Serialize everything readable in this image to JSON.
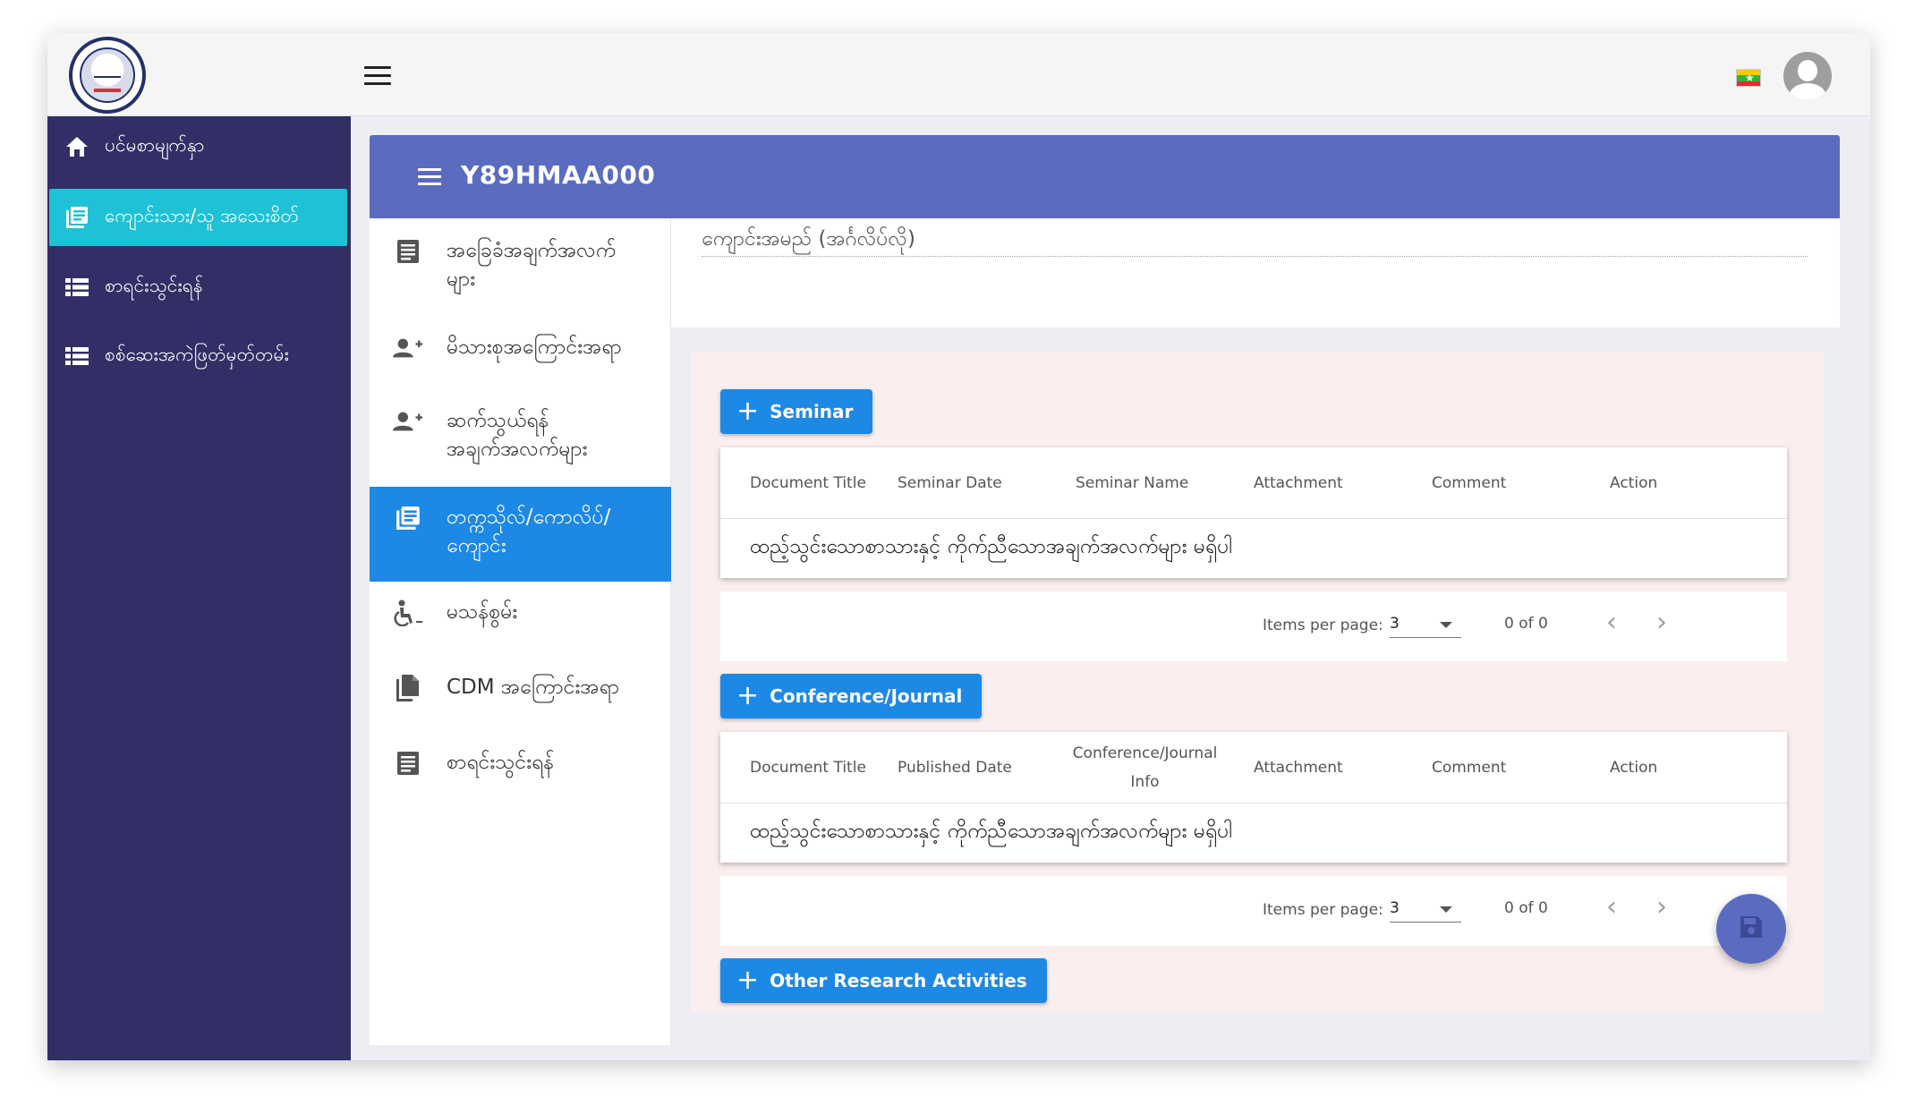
{
  "header": {
    "language_flag": "myanmar-flag"
  },
  "sidebar": {
    "items": [
      {
        "label": "ပင်မစာမျက်နှာ",
        "icon": "home-icon"
      },
      {
        "label": "ကျောင်းသား/သူ အသေးစိတ်",
        "icon": "document-list-icon"
      },
      {
        "label": "စာရင်းသွင်းရန်",
        "icon": "list-icon"
      },
      {
        "label": "စစ်ဆေးအကဲဖြတ်မှတ်တမ်း",
        "icon": "list-icon"
      }
    ]
  },
  "card": {
    "title": "Y89HMAA000"
  },
  "tabs": [
    {
      "label": "အခြေခံအချက်အလက်များ",
      "line1": "အခြေခံအချက်အလက်",
      "line2": "များ",
      "icon": "details-icon"
    },
    {
      "label": "မိသားစုအကြောင်းအရာ",
      "icon": "person-add-icon"
    },
    {
      "label": "ဆက်သွယ်ရန် အချက်အလက်များ",
      "line1": "ဆက်သွယ်ရန်",
      "line2": "အချက်အလက်များ",
      "icon": "person-add-icon"
    },
    {
      "label": "တက္ကသိုလ်/ကောလိပ်/ကျောင်း",
      "line1": "တက္ကသိုလ်/ကောလိပ်/",
      "line2": "ကျောင်း",
      "icon": "document-list-icon"
    },
    {
      "label": "မသန်စွမ်း",
      "icon": "accessibility-icon"
    },
    {
      "label": "CDM အကြောင်းအရာ",
      "icon": "file-copy-icon"
    },
    {
      "label": "စာရင်းသွင်းရန်",
      "icon": "details-icon"
    }
  ],
  "field": {
    "label": "ကျောင်းအမည် (အင်္ဂလိပ်လို)"
  },
  "seminar": {
    "button_label": "Seminar",
    "columns": [
      "Document Title",
      "Seminar Date",
      "Seminar Name",
      "Attachment",
      "Comment",
      "Action"
    ],
    "empty_text": "ထည့်သွင်းသောစာသားနှင့် ကိုက်ညီသောအချက်အလက်များ မရှိပါ",
    "pager": {
      "items_per_page_label": "Items per page:",
      "page_size": "3",
      "range": "0 of 0"
    }
  },
  "conference": {
    "button_label": "Conference/Journal",
    "columns": [
      "Document Title",
      "Published Date",
      "Conference/Journal",
      "Info",
      "Attachment",
      "Comment",
      "Action"
    ],
    "empty_text": "ထည့်သွင်းသောစာသားနှင့် ကိုက်ညီသောအချက်အလက်များ မရှိပါ",
    "pager": {
      "items_per_page_label": "Items per page:",
      "page_size": "3",
      "range": "0 of 0"
    }
  },
  "other": {
    "button_label": "Other Research Activities"
  },
  "fab": {
    "icon": "save-icon"
  },
  "colors": {
    "sidebar_bg": "#312f66",
    "sidebar_active": "#1fc1d6",
    "card_header": "#5b6bc0",
    "primary_button": "#1e88e5",
    "content_bg": "#fbeeee"
  }
}
